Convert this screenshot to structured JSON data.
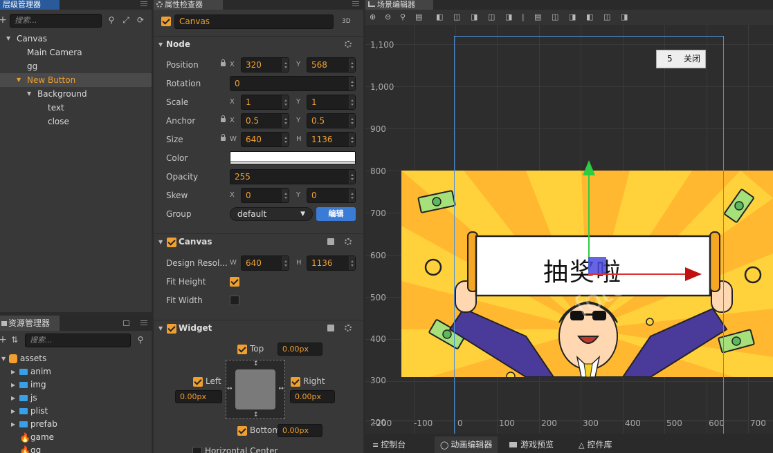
{
  "hierarchy": {
    "title": "层级管理器",
    "search_placeholder": "搜索...",
    "items": [
      {
        "label": "Canvas"
      },
      {
        "label": "Main Camera"
      },
      {
        "label": "gg"
      },
      {
        "label": "New Button"
      },
      {
        "label": "Background"
      },
      {
        "label": "text"
      },
      {
        "label": "close"
      }
    ]
  },
  "assets": {
    "title": "资源管理器",
    "search_placeholder": "搜索...",
    "root": "assets",
    "items": [
      {
        "label": "anim"
      },
      {
        "label": "img"
      },
      {
        "label": "js"
      },
      {
        "label": "plist"
      },
      {
        "label": "prefab"
      },
      {
        "label": "game"
      },
      {
        "label": "gg"
      }
    ]
  },
  "inspector": {
    "title": "属性检查器",
    "node_name": "Canvas",
    "mode_3d": "3D",
    "node_section": "Node",
    "position_label": "Position",
    "position_x": "320",
    "position_y": "568",
    "rotation_label": "Rotation",
    "rotation": "0",
    "scale_label": "Scale",
    "scale_x": "1",
    "scale_y": "1",
    "anchor_label": "Anchor",
    "anchor_x": "0.5",
    "anchor_y": "0.5",
    "size_label": "Size",
    "size_w": "640",
    "size_h": "1136",
    "color_label": "Color",
    "opacity_label": "Opacity",
    "opacity": "255",
    "skew_label": "Skew",
    "skew_x": "0",
    "skew_y": "0",
    "group_label": "Group",
    "group_value": "default",
    "edit_label": "编辑",
    "canvas_section": "Canvas",
    "design_label": "Design Resol...",
    "design_w": "640",
    "design_h": "1136",
    "fit_height_label": "Fit Height",
    "fit_width_label": "Fit Width",
    "widget_section": "Widget",
    "top_label": "Top",
    "top_value": "0.00px",
    "left_label": "Left",
    "left_value": "0.00px",
    "right_label": "Right",
    "right_value": "0.00px",
    "bottom_label": "Bottom",
    "bottom_value": "0.00px",
    "hcenter_label": "Horizontal Center",
    "axis_x": "X",
    "axis_y": "Y",
    "axis_w": "W",
    "axis_h": "H"
  },
  "scene": {
    "title": "场景编辑器",
    "y_labels": [
      "1,100",
      "1,000",
      "900",
      "800",
      "700",
      "600",
      "500",
      "400",
      "300",
      "200"
    ],
    "x_labels": [
      "-200",
      "-100",
      "0",
      "100",
      "200",
      "300",
      "400",
      "500",
      "600",
      "700"
    ],
    "countdown": "5",
    "close_label": "关闭",
    "banner_text": "抽奖啦"
  },
  "bottom_tabs": [
    {
      "label": "控制台"
    },
    {
      "label": "动画编辑器"
    },
    {
      "label": "游戏预览"
    },
    {
      "label": "控件库"
    }
  ],
  "colors": {
    "accent": "#f0a030",
    "selection": "#2a5a9a",
    "edit_button": "#3a7bd5"
  }
}
